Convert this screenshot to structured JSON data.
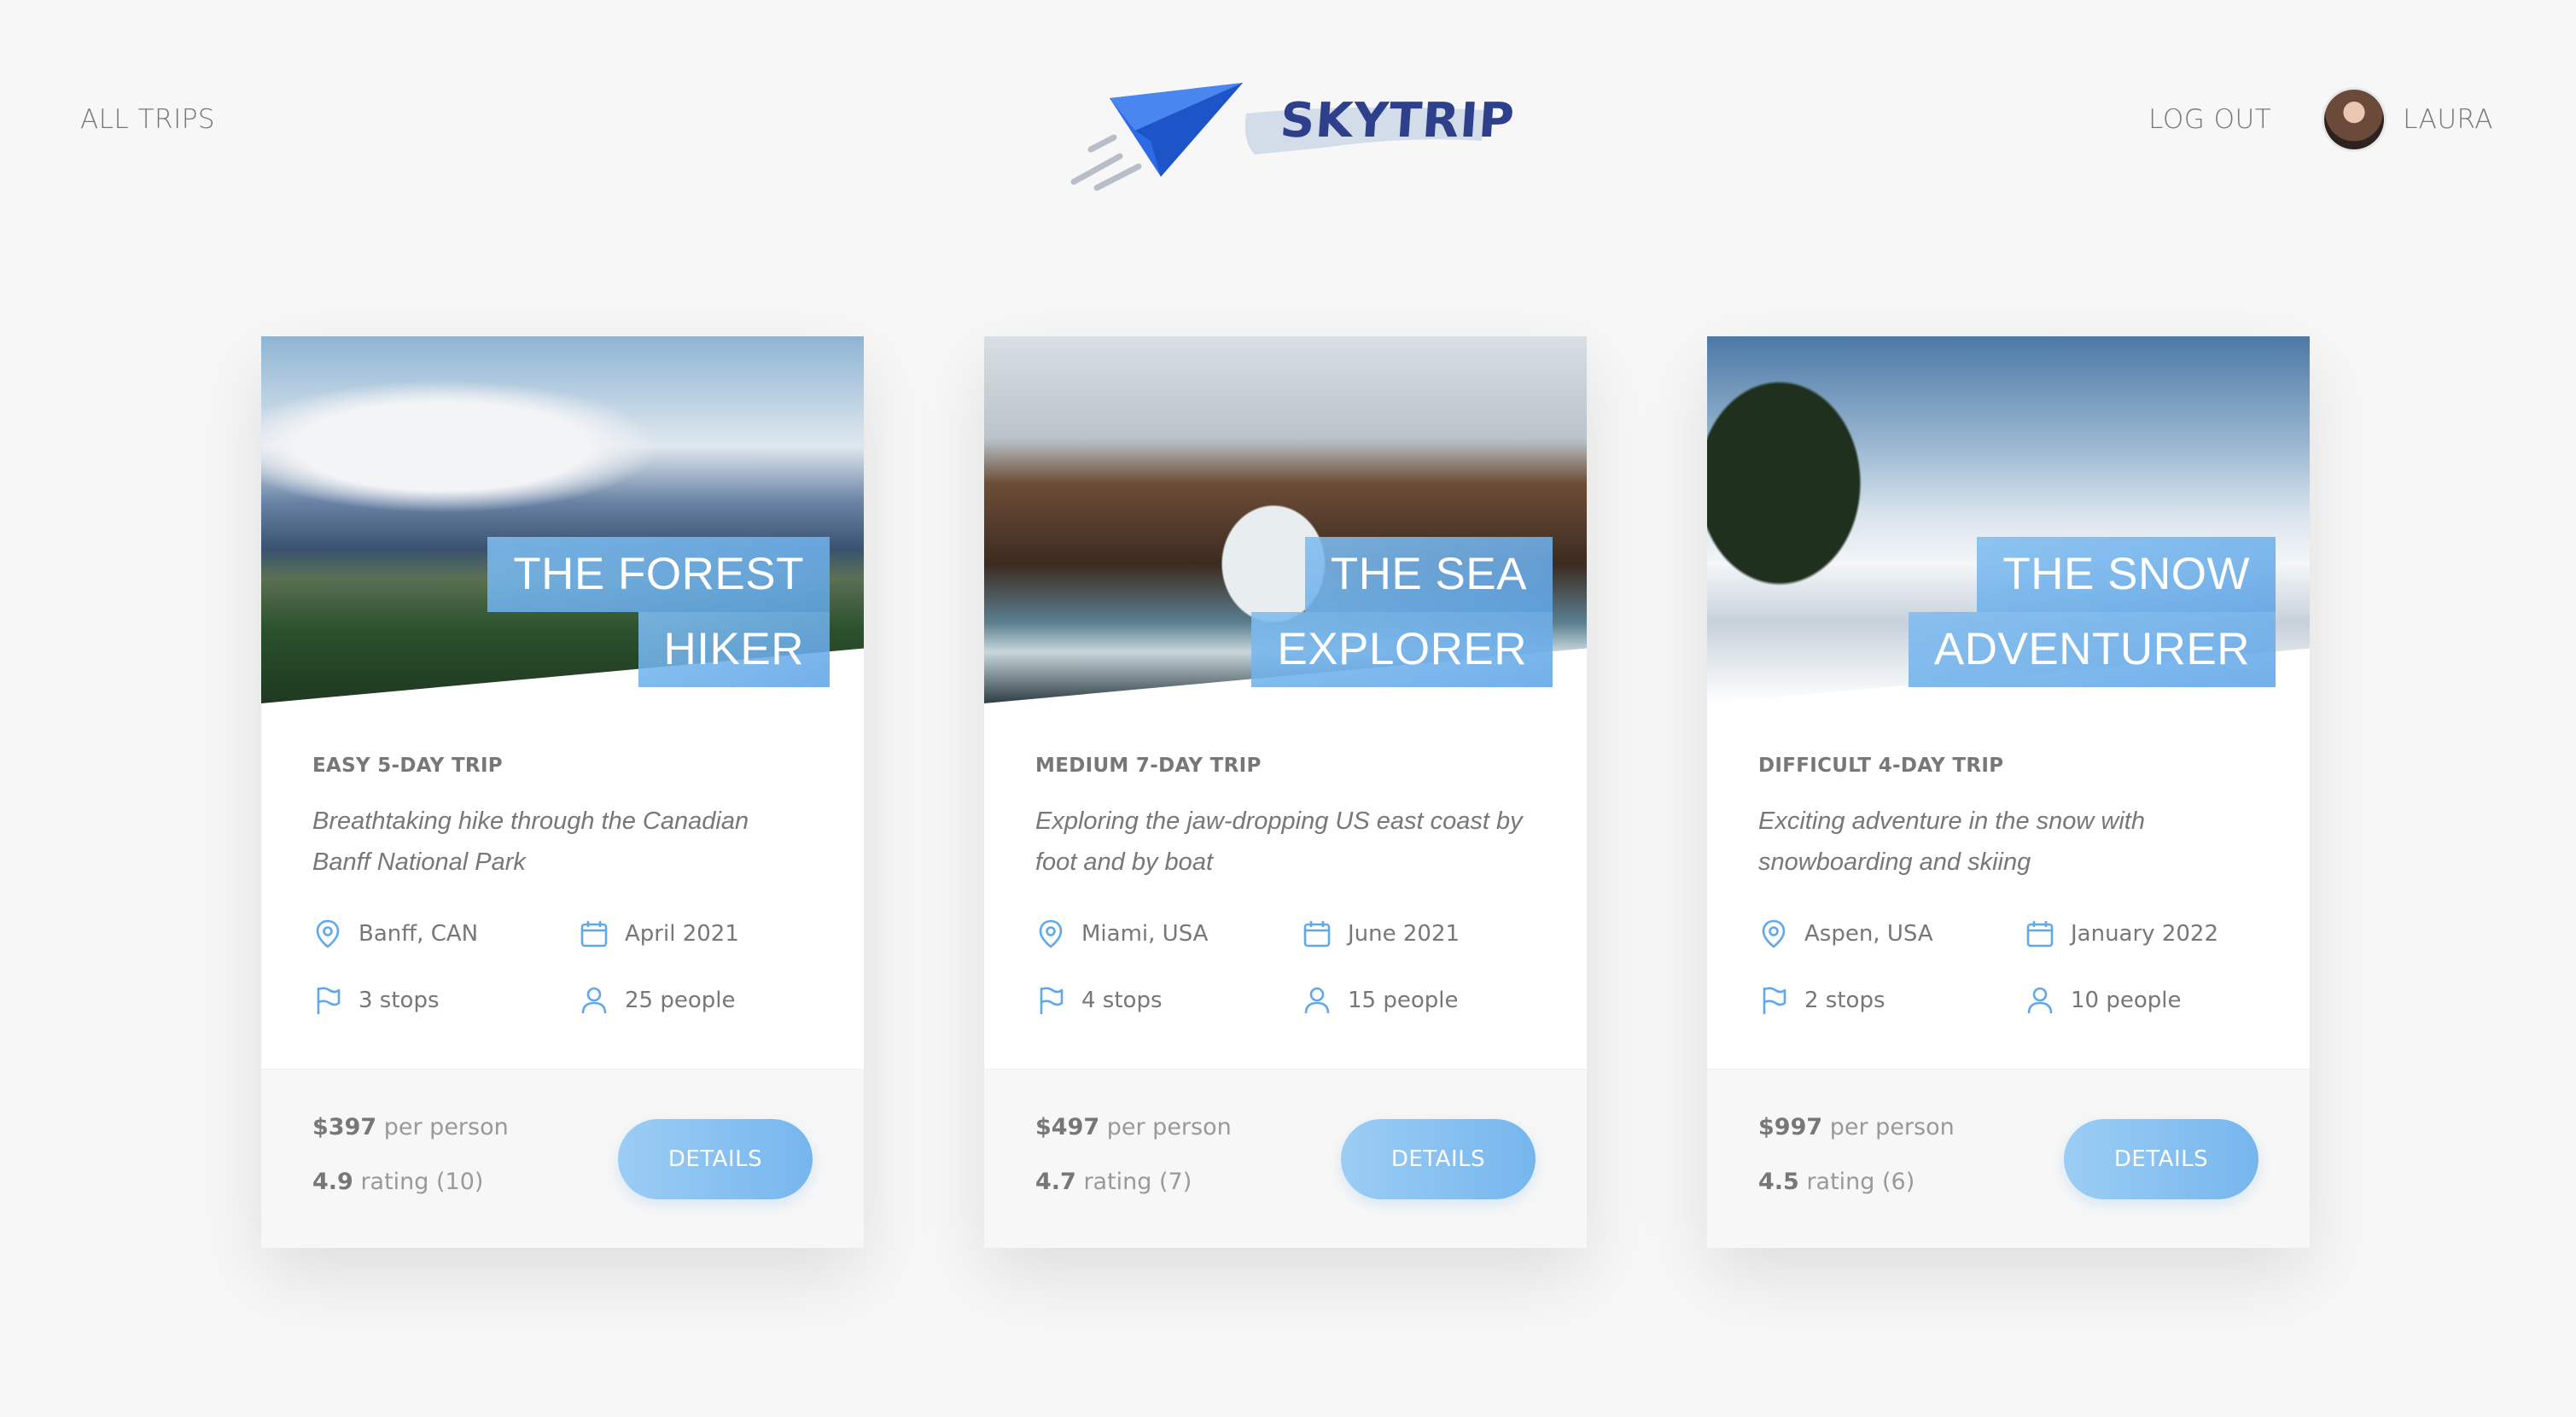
{
  "nav": {
    "all_trips": "ALL TRIPS",
    "logo_text": "SKYTRIP",
    "logout": "LOG OUT",
    "user_name": "LAURA"
  },
  "colors": {
    "background": "#f7f7f7",
    "accent_light": "#7fbdf0",
    "accent_dark": "#60a5e6",
    "logo_plane": "#2d6be6",
    "logo_text": "#2e3f8c",
    "text": "#777777"
  },
  "cards": [
    {
      "heading_line1": "THE FOREST",
      "heading_line2": "HIKER",
      "sub_heading": "EASY 5-DAY TRIP",
      "description": "Breathtaking hike through the Canadian Banff National Park",
      "location": "Banff, CAN",
      "date": "April 2021",
      "stops": "3 stops",
      "people": "25 people",
      "price_value": "$397",
      "price_suffix": "per person",
      "rating_value": "4.9",
      "rating_suffix": "rating (10)",
      "button": "DETAILS",
      "image_theme": "mountain lake forest"
    },
    {
      "heading_line1": "THE SEA",
      "heading_line2": "EXPLORER",
      "sub_heading": "MEDIUM 7-DAY TRIP",
      "description": "Exploring the jaw-dropping US east coast by foot and by boat",
      "location": "Miami, USA",
      "date": "June 2021",
      "stops": "4 stops",
      "people": "15 people",
      "price_value": "$497",
      "price_suffix": "per person",
      "rating_value": "4.7",
      "rating_suffix": "rating (7)",
      "button": "DETAILS",
      "image_theme": "sea rock arch"
    },
    {
      "heading_line1": "THE SNOW",
      "heading_line2": "ADVENTURER",
      "sub_heading": "DIFFICULT 4-DAY TRIP",
      "description": "Exciting adventure in the snow with snowboarding and skiing",
      "location": "Aspen, USA",
      "date": "January 2022",
      "stops": "2 stops",
      "people": "10 people",
      "price_value": "$997",
      "price_suffix": "per person",
      "rating_value": "4.5",
      "rating_suffix": "rating (6)",
      "button": "DETAILS",
      "image_theme": "snowy mountain trail"
    }
  ],
  "icons": {
    "location": "map-pin-icon",
    "date": "calendar-icon",
    "stops": "flag-icon",
    "people": "user-icon"
  }
}
